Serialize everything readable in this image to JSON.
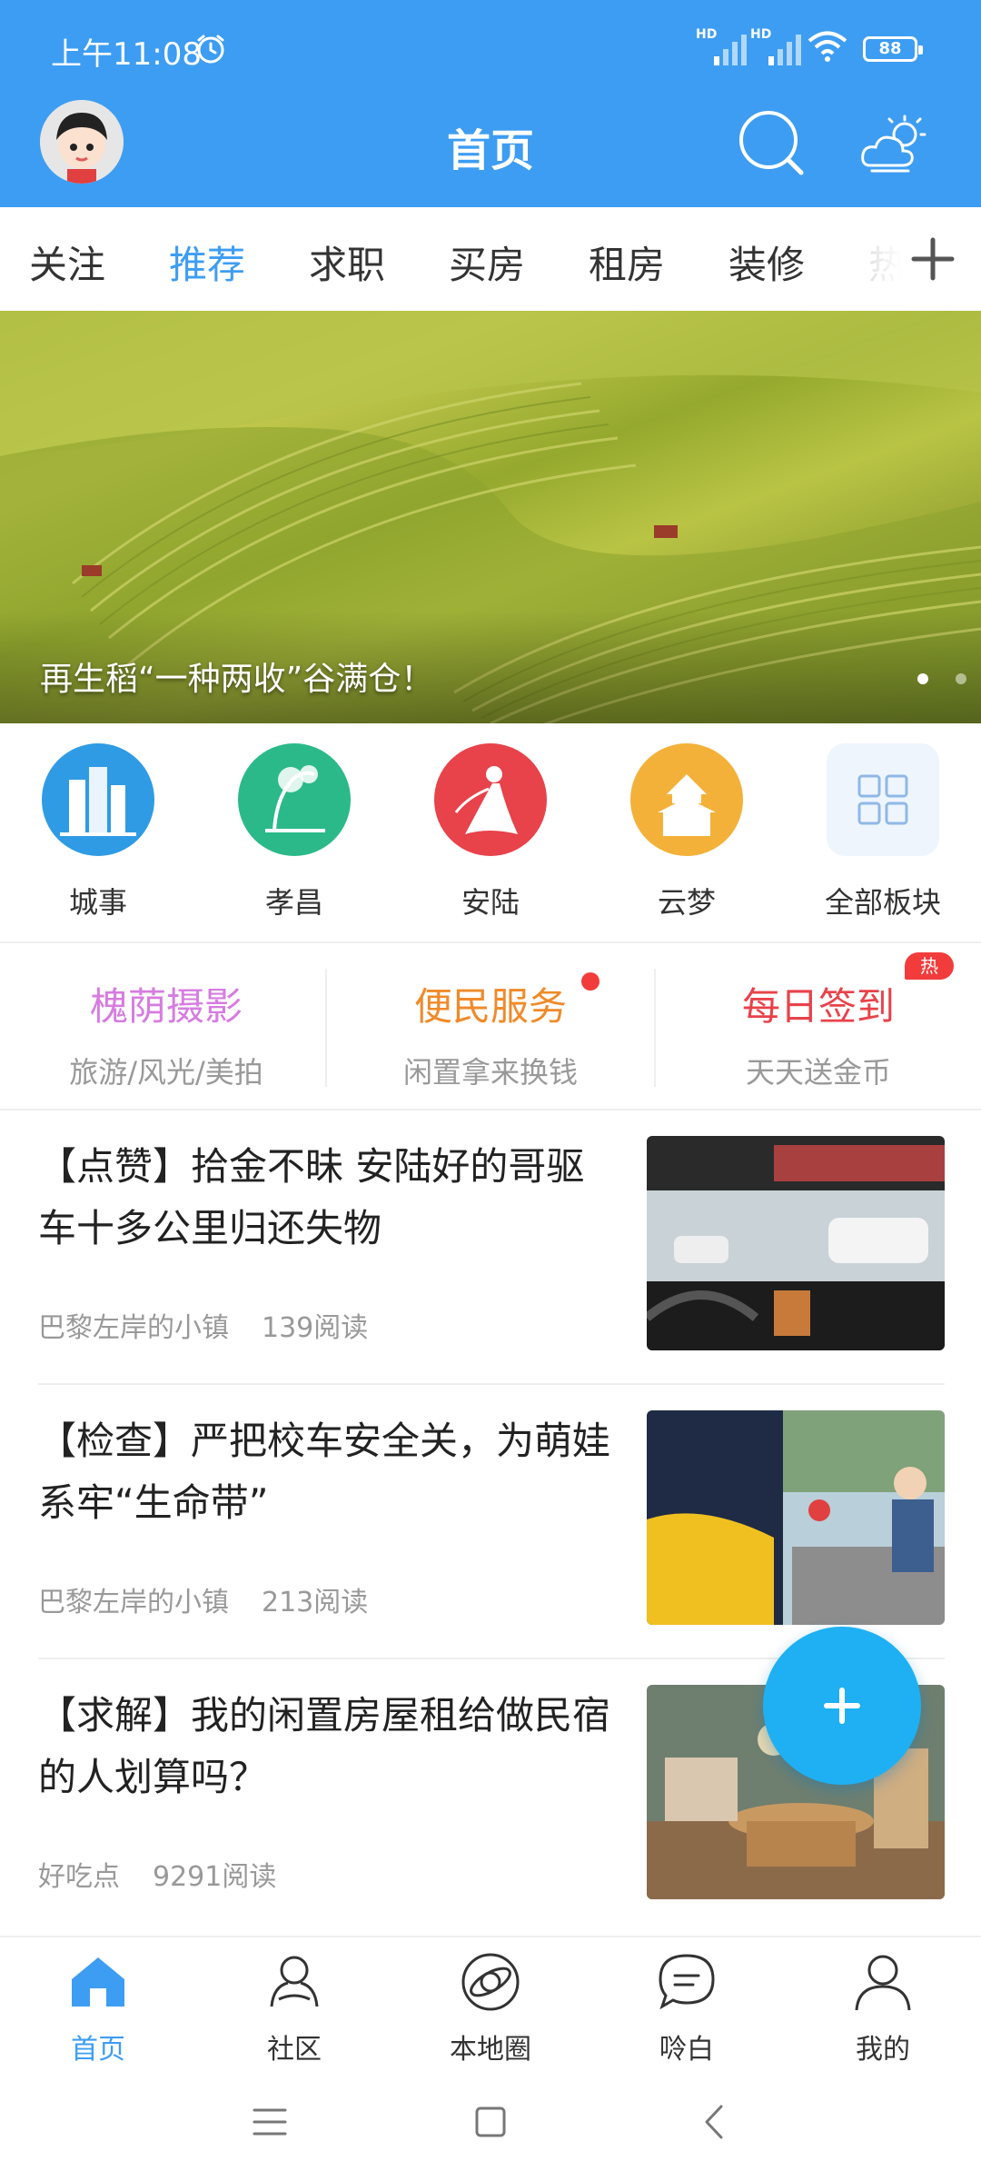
{
  "status_bar": {
    "time": "上午11:08",
    "battery": "88",
    "hd1": "HD",
    "hd2": "HD"
  },
  "header": {
    "title": "首页"
  },
  "tabs": [
    {
      "label": "关注",
      "active": false
    },
    {
      "label": "推荐",
      "active": true
    },
    {
      "label": "求职",
      "active": false
    },
    {
      "label": "买房",
      "active": false
    },
    {
      "label": "租房",
      "active": false
    },
    {
      "label": "装修",
      "active": false
    },
    {
      "label": "热",
      "active": false
    }
  ],
  "banner": {
    "caption": "再生稻“一种两收”谷满仓！"
  },
  "boards": [
    {
      "label": "城事",
      "icon": "city-buildings-icon",
      "color": "#2f9be4"
    },
    {
      "label": "孝昌",
      "icon": "landscape-painting-icon",
      "color": "#2bb98a"
    },
    {
      "label": "安陆",
      "icon": "lady-silhouette-icon",
      "color": "#e8424a"
    },
    {
      "label": "云梦",
      "icon": "pavilion-icon",
      "color": "#f4b13a"
    },
    {
      "label": "全部板块",
      "icon": "grid-icon",
      "color": "#8fb8e6"
    }
  ],
  "services": [
    {
      "title": "槐荫摄影",
      "subtitle": "旅游/风光/美拍",
      "color": "#d67ce0"
    },
    {
      "title": "便民服务",
      "subtitle": "闲置拿来换钱",
      "color": "#f08a2a"
    },
    {
      "title": "每日签到",
      "subtitle": "天天送金币",
      "color": "#e8424a",
      "badge": "热"
    }
  ],
  "feed": [
    {
      "title": "【点赞】拾金不昧 安陆好的哥驱车十多公里归还失物",
      "author": "巴黎左岸的小镇",
      "reads": "139阅读"
    },
    {
      "title": "【检查】严把校车安全关，为萌娃系牢“生命带”",
      "author": "巴黎左岸的小镇",
      "reads": "213阅读"
    },
    {
      "title": "【求解】我的闲置房屋租给做民宿的人划算吗？",
      "author": "好吃点",
      "reads": "9291阅读"
    }
  ],
  "bottom_nav": [
    {
      "label": "首页",
      "icon": "home-icon",
      "active": true
    },
    {
      "label": "社区",
      "icon": "community-icon",
      "active": false
    },
    {
      "label": "本地圈",
      "icon": "local-circle-icon",
      "active": false
    },
    {
      "label": "唥白",
      "icon": "chat-bubble-icon",
      "active": false
    },
    {
      "label": "我的",
      "icon": "profile-icon",
      "active": false
    }
  ],
  "colors": {
    "primary": "#3d9df2",
    "fab": "#1fb0f3",
    "badge": "#f23c3c"
  }
}
